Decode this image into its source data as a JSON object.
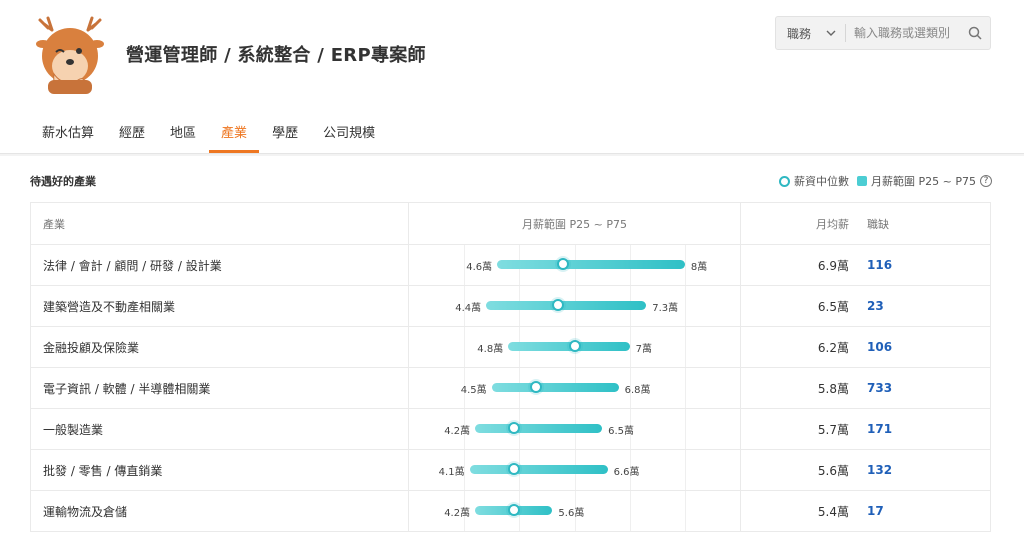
{
  "title": "營運管理師 / 系統整合 / ERP專案師",
  "search": {
    "select_value": "職務",
    "placeholder": "輸入職務或選類別"
  },
  "tabs": [
    {
      "label": "薪水估算"
    },
    {
      "label": "經歷"
    },
    {
      "label": "地區"
    },
    {
      "label": "產業",
      "active": true
    },
    {
      "label": "學歷"
    },
    {
      "label": "公司規模"
    }
  ],
  "section_title": "待遇好的產業",
  "legend": {
    "median": "薪資中位數",
    "range": "月薪範圍 P25 ~ P75",
    "help": "?"
  },
  "table": {
    "headers": {
      "industry": "產業",
      "range": "月薪範圍 P25 ~ P75",
      "avg": "月均薪",
      "jobs": "職缺"
    },
    "rows": [
      {
        "industry": "法律 / 會計 / 顧問 / 研發 / 設計業",
        "p25_label": "4.6萬",
        "p75_label": "8萬",
        "p25": 4.6,
        "p75": 8.0,
        "median": 5.8,
        "avg": "6.9萬",
        "jobs": "116"
      },
      {
        "industry": "建築營造及不動產相關業",
        "p25_label": "4.4萬",
        "p75_label": "7.3萬",
        "p25": 4.4,
        "p75": 7.3,
        "median": 5.7,
        "avg": "6.5萬",
        "jobs": "23"
      },
      {
        "industry": "金融投顧及保險業",
        "p25_label": "4.8萬",
        "p75_label": "7萬",
        "p25": 4.8,
        "p75": 7.0,
        "median": 6.0,
        "avg": "6.2萬",
        "jobs": "106"
      },
      {
        "industry": "電子資訊 / 軟體 / 半導體相關業",
        "p25_label": "4.5萬",
        "p75_label": "6.8萬",
        "p25": 4.5,
        "p75": 6.8,
        "median": 5.3,
        "avg": "5.8萬",
        "jobs": "733"
      },
      {
        "industry": "一般製造業",
        "p25_label": "4.2萬",
        "p75_label": "6.5萬",
        "p25": 4.2,
        "p75": 6.5,
        "median": 4.9,
        "avg": "5.7萬",
        "jobs": "171"
      },
      {
        "industry": "批發 / 零售 / 傳直銷業",
        "p25_label": "4.1萬",
        "p75_label": "6.6萬",
        "p25": 4.1,
        "p75": 6.6,
        "median": 4.9,
        "avg": "5.6萬",
        "jobs": "132"
      },
      {
        "industry": "運輸物流及倉儲",
        "p25_label": "4.2萬",
        "p75_label": "5.6萬",
        "p25": 4.2,
        "p75": 5.6,
        "median": 4.9,
        "avg": "5.4萬",
        "jobs": "17"
      }
    ]
  },
  "colors": {
    "accent": "#ee7722",
    "bar": "#4ccdd3",
    "link": "#1f5fb8"
  }
}
